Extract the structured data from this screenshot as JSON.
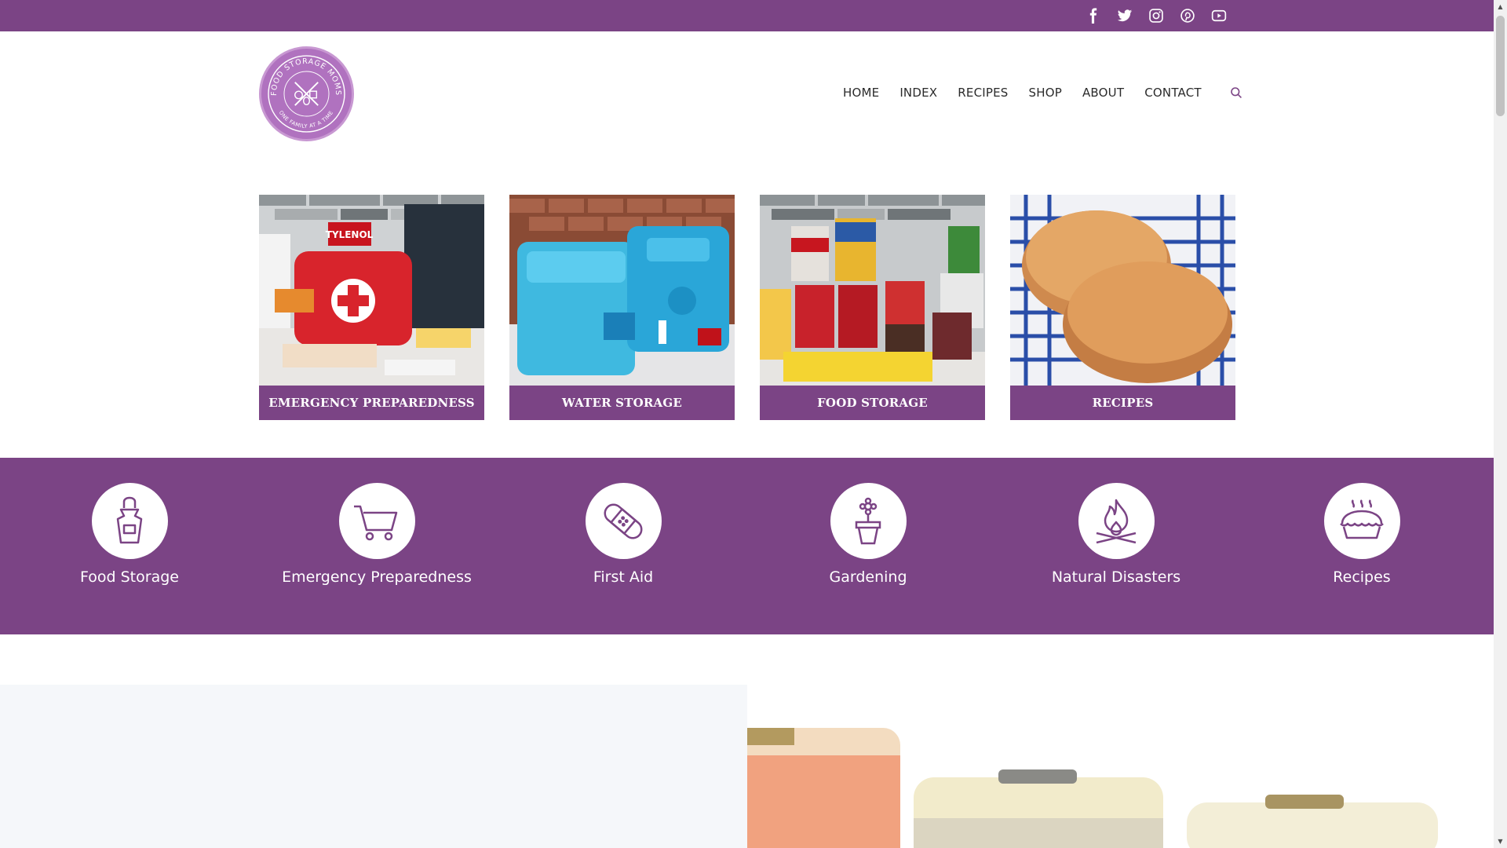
{
  "social": [
    {
      "icon": "facebook-icon"
    },
    {
      "icon": "twitter-icon"
    },
    {
      "icon": "instagram-icon"
    },
    {
      "icon": "pinterest-icon"
    },
    {
      "icon": "youtube-icon"
    }
  ],
  "logo": {
    "top_text": "FOOD STORAGE MOMS",
    "bottom_text": "ONE FAMILY AT A TIME"
  },
  "nav": {
    "items": [
      "HOME",
      "INDEX",
      "RECIPES",
      "SHOP",
      "ABOUT",
      "CONTACT"
    ],
    "search_icon": "search-icon"
  },
  "cards": [
    {
      "label": "EMERGENCY PREPAREDNESS",
      "image": "first-aid-kit"
    },
    {
      "label": "WATER STORAGE",
      "image": "water-containers"
    },
    {
      "label": "FOOD STORAGE",
      "image": "canned-goods"
    },
    {
      "label": "RECIPES",
      "image": "bread-loaves"
    }
  ],
  "band": {
    "items": [
      {
        "label": "Food Storage",
        "icon": "apron-icon"
      },
      {
        "label": "Emergency Preparedness",
        "icon": "shopping-cart-icon"
      },
      {
        "label": "First Aid",
        "icon": "bandage-icon"
      },
      {
        "label": "Gardening",
        "icon": "flower-pot-icon"
      },
      {
        "label": "Natural Disasters",
        "icon": "fire-icon"
      },
      {
        "label": "Recipes",
        "icon": "pie-icon"
      }
    ]
  },
  "colors": {
    "brand_purple": "#7b4485",
    "logo_purple": "#b072bf"
  }
}
